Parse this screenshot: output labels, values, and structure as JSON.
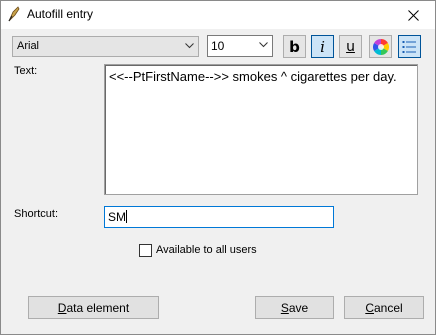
{
  "window": {
    "title": "Autofill entry"
  },
  "toolbar": {
    "font_value": "Arial",
    "size_value": "10",
    "bold_label": "b",
    "italic_label": "i",
    "underline_label": "u"
  },
  "form": {
    "text_label": "Text:",
    "text_value": "<<--PtFirstName-->> smokes ^ cigarettes per day.",
    "shortcut_label": "Shortcut:",
    "shortcut_value": "SM",
    "checkbox_label": "Available to all users",
    "checkbox_checked": false
  },
  "buttons": {
    "data_element": {
      "mnemonic": "D",
      "rest": "ata element"
    },
    "save": {
      "mnemonic": "S",
      "rest": "ave"
    },
    "cancel": {
      "mnemonic": "C",
      "rest": "ancel"
    }
  },
  "icons": {
    "app": "quill-pen-icon",
    "close": "close-icon",
    "dropdown": "chevron-down-icon",
    "color": "color-wheel-icon",
    "list": "bullet-list-icon"
  }
}
